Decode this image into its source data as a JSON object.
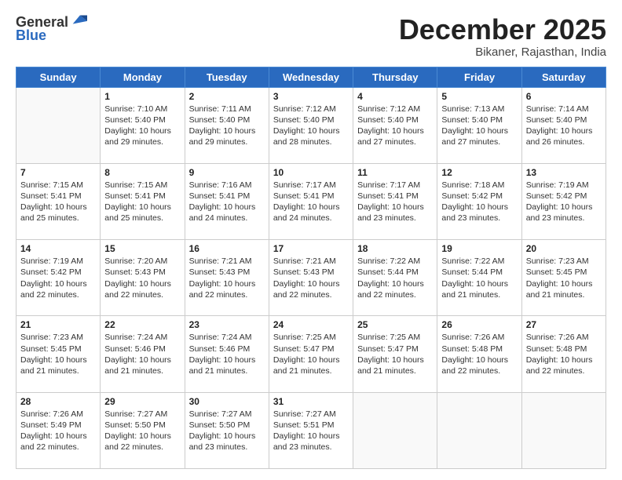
{
  "header": {
    "logo_line1": "General",
    "logo_line2": "Blue",
    "month": "December 2025",
    "location": "Bikaner, Rajasthan, India"
  },
  "days_of_week": [
    "Sunday",
    "Monday",
    "Tuesday",
    "Wednesday",
    "Thursday",
    "Friday",
    "Saturday"
  ],
  "weeks": [
    [
      {
        "day": "",
        "info": ""
      },
      {
        "day": "1",
        "info": "Sunrise: 7:10 AM\nSunset: 5:40 PM\nDaylight: 10 hours\nand 29 minutes."
      },
      {
        "day": "2",
        "info": "Sunrise: 7:11 AM\nSunset: 5:40 PM\nDaylight: 10 hours\nand 29 minutes."
      },
      {
        "day": "3",
        "info": "Sunrise: 7:12 AM\nSunset: 5:40 PM\nDaylight: 10 hours\nand 28 minutes."
      },
      {
        "day": "4",
        "info": "Sunrise: 7:12 AM\nSunset: 5:40 PM\nDaylight: 10 hours\nand 27 minutes."
      },
      {
        "day": "5",
        "info": "Sunrise: 7:13 AM\nSunset: 5:40 PM\nDaylight: 10 hours\nand 27 minutes."
      },
      {
        "day": "6",
        "info": "Sunrise: 7:14 AM\nSunset: 5:40 PM\nDaylight: 10 hours\nand 26 minutes."
      }
    ],
    [
      {
        "day": "7",
        "info": "Sunrise: 7:15 AM\nSunset: 5:41 PM\nDaylight: 10 hours\nand 25 minutes."
      },
      {
        "day": "8",
        "info": "Sunrise: 7:15 AM\nSunset: 5:41 PM\nDaylight: 10 hours\nand 25 minutes."
      },
      {
        "day": "9",
        "info": "Sunrise: 7:16 AM\nSunset: 5:41 PM\nDaylight: 10 hours\nand 24 minutes."
      },
      {
        "day": "10",
        "info": "Sunrise: 7:17 AM\nSunset: 5:41 PM\nDaylight: 10 hours\nand 24 minutes."
      },
      {
        "day": "11",
        "info": "Sunrise: 7:17 AM\nSunset: 5:41 PM\nDaylight: 10 hours\nand 23 minutes."
      },
      {
        "day": "12",
        "info": "Sunrise: 7:18 AM\nSunset: 5:42 PM\nDaylight: 10 hours\nand 23 minutes."
      },
      {
        "day": "13",
        "info": "Sunrise: 7:19 AM\nSunset: 5:42 PM\nDaylight: 10 hours\nand 23 minutes."
      }
    ],
    [
      {
        "day": "14",
        "info": "Sunrise: 7:19 AM\nSunset: 5:42 PM\nDaylight: 10 hours\nand 22 minutes."
      },
      {
        "day": "15",
        "info": "Sunrise: 7:20 AM\nSunset: 5:43 PM\nDaylight: 10 hours\nand 22 minutes."
      },
      {
        "day": "16",
        "info": "Sunrise: 7:21 AM\nSunset: 5:43 PM\nDaylight: 10 hours\nand 22 minutes."
      },
      {
        "day": "17",
        "info": "Sunrise: 7:21 AM\nSunset: 5:43 PM\nDaylight: 10 hours\nand 22 minutes."
      },
      {
        "day": "18",
        "info": "Sunrise: 7:22 AM\nSunset: 5:44 PM\nDaylight: 10 hours\nand 22 minutes."
      },
      {
        "day": "19",
        "info": "Sunrise: 7:22 AM\nSunset: 5:44 PM\nDaylight: 10 hours\nand 21 minutes."
      },
      {
        "day": "20",
        "info": "Sunrise: 7:23 AM\nSunset: 5:45 PM\nDaylight: 10 hours\nand 21 minutes."
      }
    ],
    [
      {
        "day": "21",
        "info": "Sunrise: 7:23 AM\nSunset: 5:45 PM\nDaylight: 10 hours\nand 21 minutes."
      },
      {
        "day": "22",
        "info": "Sunrise: 7:24 AM\nSunset: 5:46 PM\nDaylight: 10 hours\nand 21 minutes."
      },
      {
        "day": "23",
        "info": "Sunrise: 7:24 AM\nSunset: 5:46 PM\nDaylight: 10 hours\nand 21 minutes."
      },
      {
        "day": "24",
        "info": "Sunrise: 7:25 AM\nSunset: 5:47 PM\nDaylight: 10 hours\nand 21 minutes."
      },
      {
        "day": "25",
        "info": "Sunrise: 7:25 AM\nSunset: 5:47 PM\nDaylight: 10 hours\nand 21 minutes."
      },
      {
        "day": "26",
        "info": "Sunrise: 7:26 AM\nSunset: 5:48 PM\nDaylight: 10 hours\nand 22 minutes."
      },
      {
        "day": "27",
        "info": "Sunrise: 7:26 AM\nSunset: 5:48 PM\nDaylight: 10 hours\nand 22 minutes."
      }
    ],
    [
      {
        "day": "28",
        "info": "Sunrise: 7:26 AM\nSunset: 5:49 PM\nDaylight: 10 hours\nand 22 minutes."
      },
      {
        "day": "29",
        "info": "Sunrise: 7:27 AM\nSunset: 5:50 PM\nDaylight: 10 hours\nand 22 minutes."
      },
      {
        "day": "30",
        "info": "Sunrise: 7:27 AM\nSunset: 5:50 PM\nDaylight: 10 hours\nand 23 minutes."
      },
      {
        "day": "31",
        "info": "Sunrise: 7:27 AM\nSunset: 5:51 PM\nDaylight: 10 hours\nand 23 minutes."
      },
      {
        "day": "",
        "info": ""
      },
      {
        "day": "",
        "info": ""
      },
      {
        "day": "",
        "info": ""
      }
    ]
  ]
}
